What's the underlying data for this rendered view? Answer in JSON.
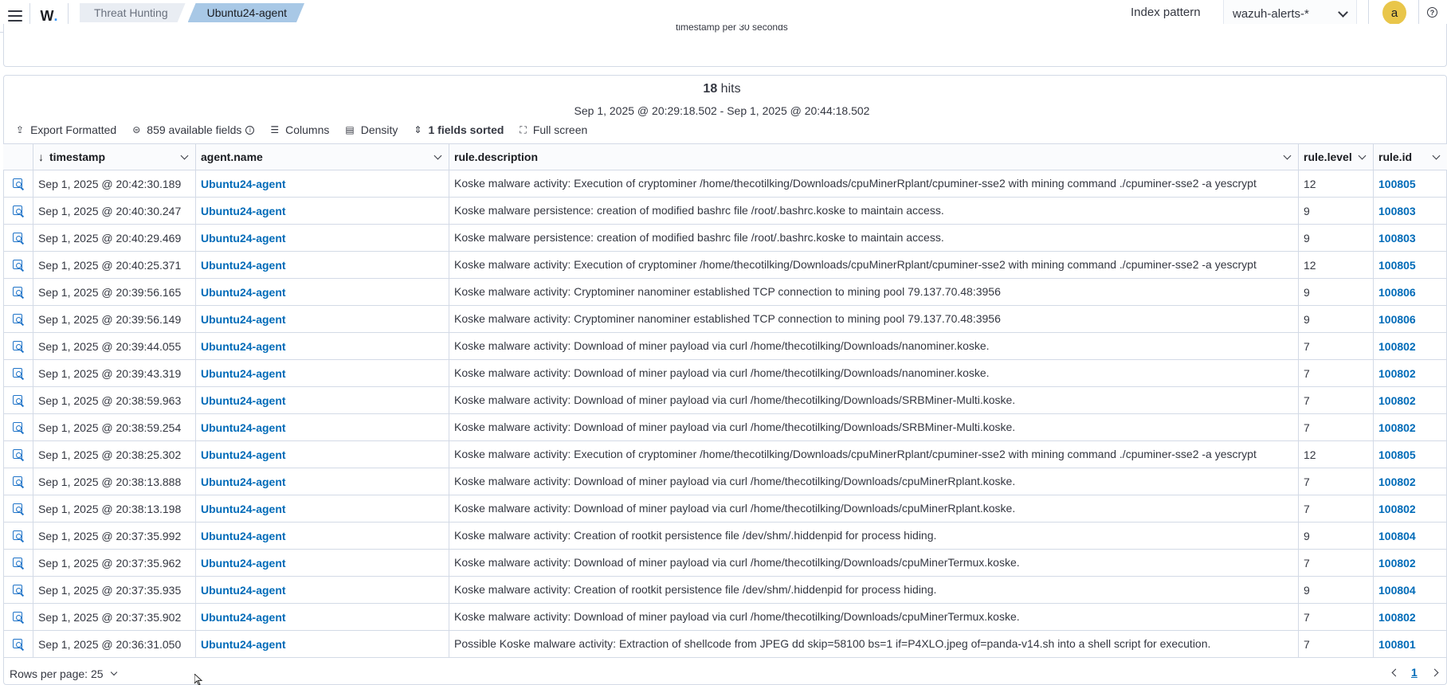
{
  "header": {
    "breadcrumbs": [
      "Threat Hunting",
      "Ubuntu24-agent"
    ],
    "index_pattern_label": "Index pattern",
    "index_pattern_value": "wazuh-alerts-*",
    "avatar_letter": "a",
    "help_glyph": "?"
  },
  "histogram": {
    "axis_label": "timestamp per 30 seconds"
  },
  "results": {
    "hits_count": "18",
    "hits_label": "hits",
    "time_range": "Sep 1, 2025 @ 20:29:18.502 - Sep 1, 2025 @ 20:44:18.502"
  },
  "toolbar": {
    "export_label": "Export Formatted",
    "fields_label": "859 available fields",
    "columns_label": "Columns",
    "density_label": "Density",
    "sorted_label": "1 fields sorted",
    "fullscreen_label": "Full screen"
  },
  "table": {
    "columns": [
      "timestamp",
      "agent.name",
      "rule.description",
      "rule.level",
      "rule.id"
    ],
    "rows": [
      {
        "timestamp": "Sep 1, 2025 @ 20:42:30.189",
        "agent": "Ubuntu24-agent",
        "description": "Koske malware activity: Execution of cryptominer /home/thecotilking/Downloads/cpuMinerRplant/cpuminer-sse2 with mining command ./cpuminer-sse2 -a yescrypt",
        "level": "12",
        "id": "100805"
      },
      {
        "timestamp": "Sep 1, 2025 @ 20:40:30.247",
        "agent": "Ubuntu24-agent",
        "description": "Koske malware persistence: creation of modified bashrc file /root/.bashrc.koske to maintain access.",
        "level": "9",
        "id": "100803"
      },
      {
        "timestamp": "Sep 1, 2025 @ 20:40:29.469",
        "agent": "Ubuntu24-agent",
        "description": "Koske malware persistence: creation of modified bashrc file /root/.bashrc.koske to maintain access.",
        "level": "9",
        "id": "100803"
      },
      {
        "timestamp": "Sep 1, 2025 @ 20:40:25.371",
        "agent": "Ubuntu24-agent",
        "description": "Koske malware activity: Execution of cryptominer /home/thecotilking/Downloads/cpuMinerRplant/cpuminer-sse2 with mining command ./cpuminer-sse2 -a yescrypt",
        "level": "12",
        "id": "100805"
      },
      {
        "timestamp": "Sep 1, 2025 @ 20:39:56.165",
        "agent": "Ubuntu24-agent",
        "description": "Koske malware activity: Cryptominer nanominer established TCP connection to mining pool 79.137.70.48:3956",
        "level": "9",
        "id": "100806"
      },
      {
        "timestamp": "Sep 1, 2025 @ 20:39:56.149",
        "agent": "Ubuntu24-agent",
        "description": "Koske malware activity: Cryptominer nanominer established TCP connection to mining pool 79.137.70.48:3956",
        "level": "9",
        "id": "100806"
      },
      {
        "timestamp": "Sep 1, 2025 @ 20:39:44.055",
        "agent": "Ubuntu24-agent",
        "description": "Koske malware activity: Download of miner payload via curl /home/thecotilking/Downloads/nanominer.koske.",
        "level": "7",
        "id": "100802"
      },
      {
        "timestamp": "Sep 1, 2025 @ 20:39:43.319",
        "agent": "Ubuntu24-agent",
        "description": "Koske malware activity: Download of miner payload via curl /home/thecotilking/Downloads/nanominer.koske.",
        "level": "7",
        "id": "100802"
      },
      {
        "timestamp": "Sep 1, 2025 @ 20:38:59.963",
        "agent": "Ubuntu24-agent",
        "description": "Koske malware activity: Download of miner payload via curl /home/thecotilking/Downloads/SRBMiner-Multi.koske.",
        "level": "7",
        "id": "100802"
      },
      {
        "timestamp": "Sep 1, 2025 @ 20:38:59.254",
        "agent": "Ubuntu24-agent",
        "description": "Koske malware activity: Download of miner payload via curl /home/thecotilking/Downloads/SRBMiner-Multi.koske.",
        "level": "7",
        "id": "100802"
      },
      {
        "timestamp": "Sep 1, 2025 @ 20:38:25.302",
        "agent": "Ubuntu24-agent",
        "description": "Koske malware activity: Execution of cryptominer /home/thecotilking/Downloads/cpuMinerRplant/cpuminer-sse2 with mining command ./cpuminer-sse2 -a yescrypt",
        "level": "12",
        "id": "100805"
      },
      {
        "timestamp": "Sep 1, 2025 @ 20:38:13.888",
        "agent": "Ubuntu24-agent",
        "description": "Koske malware activity: Download of miner payload via curl /home/thecotilking/Downloads/cpuMinerRplant.koske.",
        "level": "7",
        "id": "100802"
      },
      {
        "timestamp": "Sep 1, 2025 @ 20:38:13.198",
        "agent": "Ubuntu24-agent",
        "description": "Koske malware activity: Download of miner payload via curl /home/thecotilking/Downloads/cpuMinerRplant.koske.",
        "level": "7",
        "id": "100802"
      },
      {
        "timestamp": "Sep 1, 2025 @ 20:37:35.992",
        "agent": "Ubuntu24-agent",
        "description": "Koske malware activity: Creation of rootkit persistence file /dev/shm/.hiddenpid for process hiding.",
        "level": "9",
        "id": "100804"
      },
      {
        "timestamp": "Sep 1, 2025 @ 20:37:35.962",
        "agent": "Ubuntu24-agent",
        "description": "Koske malware activity: Download of miner payload via curl /home/thecotilking/Downloads/cpuMinerTermux.koske.",
        "level": "7",
        "id": "100802"
      },
      {
        "timestamp": "Sep 1, 2025 @ 20:37:35.935",
        "agent": "Ubuntu24-agent",
        "description": "Koske malware activity: Creation of rootkit persistence file /dev/shm/.hiddenpid for process hiding.",
        "level": "9",
        "id": "100804"
      },
      {
        "timestamp": "Sep 1, 2025 @ 20:37:35.902",
        "agent": "Ubuntu24-agent",
        "description": "Koske malware activity: Download of miner payload via curl /home/thecotilking/Downloads/cpuMinerTermux.koske.",
        "level": "7",
        "id": "100802"
      },
      {
        "timestamp": "Sep 1, 2025 @ 20:36:31.050",
        "agent": "Ubuntu24-agent",
        "description": "Possible Koske malware activity: Extraction of shellcode from JPEG dd skip=58100 bs=1 if=P4XLO.jpeg of=panda-v14.sh into a shell script for execution.",
        "level": "7",
        "id": "100801"
      }
    ]
  },
  "footer": {
    "rows_per_page": "Rows per page: 25",
    "current_page": "1"
  },
  "icons": {
    "menu": "hamburger-icon",
    "inspect": "inspect-document-icon",
    "export": "export-icon",
    "fields": "fields-icon",
    "columns": "list-icon",
    "density": "table-density-icon",
    "sort": "sort-icon",
    "fullscreen": "fullscreen-icon"
  },
  "colors": {
    "link": "#006bb8",
    "active_breadcrumb": "#a8c8e6",
    "avatar": "#e9c64a"
  }
}
